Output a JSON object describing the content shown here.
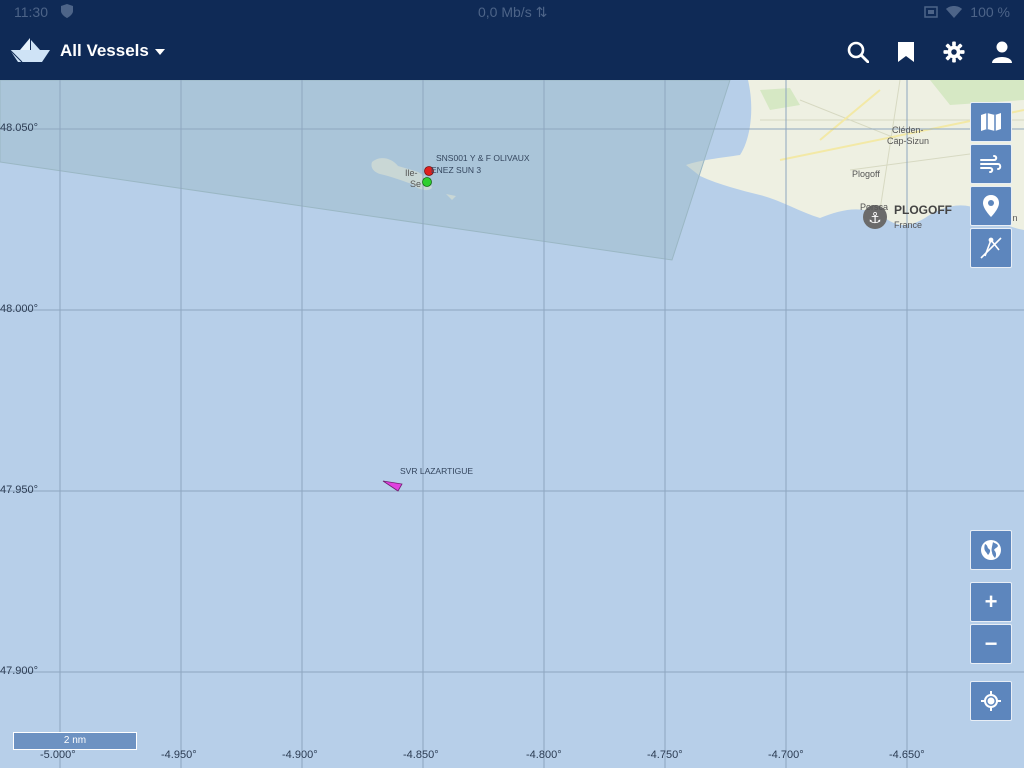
{
  "statusbar": {
    "time": "11:30",
    "speed": "0,0 Mb/s",
    "battery": "100 %"
  },
  "appbar": {
    "title": "All Vessels",
    "icons": [
      "search-icon",
      "bookmark-icon",
      "settings-icon",
      "account-icon"
    ]
  },
  "map": {
    "latitudes": [
      "48.050°",
      "48.000°",
      "47.950°",
      "47.900°"
    ],
    "longitudes": [
      "-5.000°",
      "-4.950°",
      "-4.900°",
      "-4.850°",
      "-4.800°",
      "-4.750°",
      "-4.700°",
      "-4.650°"
    ],
    "vessels": {
      "v1": "SNS001 Y & F OLIVAUX",
      "v2": "ENEZ SUN 3",
      "v3": "SVR LAZARTIGUE"
    },
    "places": {
      "ile": "Ile-",
      "se": "Se",
      "cleden": "Cléden-",
      "capsizun": "Cap-Sizun",
      "plogoff_small": "Plogoff",
      "plogoff": "PLOGOFF",
      "france": "France",
      "primelin": "Primelin",
      "port": "Porsca"
    },
    "scale": "2 nm"
  },
  "controls": {
    "top": [
      "map-layers-icon",
      "wind-icon",
      "place-marker-icon",
      "compass-icon"
    ],
    "bottom": [
      "globe-icon",
      "zoom-in",
      "zoom-out",
      "my-location-icon"
    ],
    "zoom_in": "+",
    "zoom_out": "−"
  },
  "colors": {
    "appbar": "#0f2a56",
    "sea": "#b7cfe9",
    "control": "#5d86bd",
    "vessel_red": "#e0201f",
    "vessel_green": "#2fcf2f",
    "vessel_magenta": "#e040e0"
  }
}
